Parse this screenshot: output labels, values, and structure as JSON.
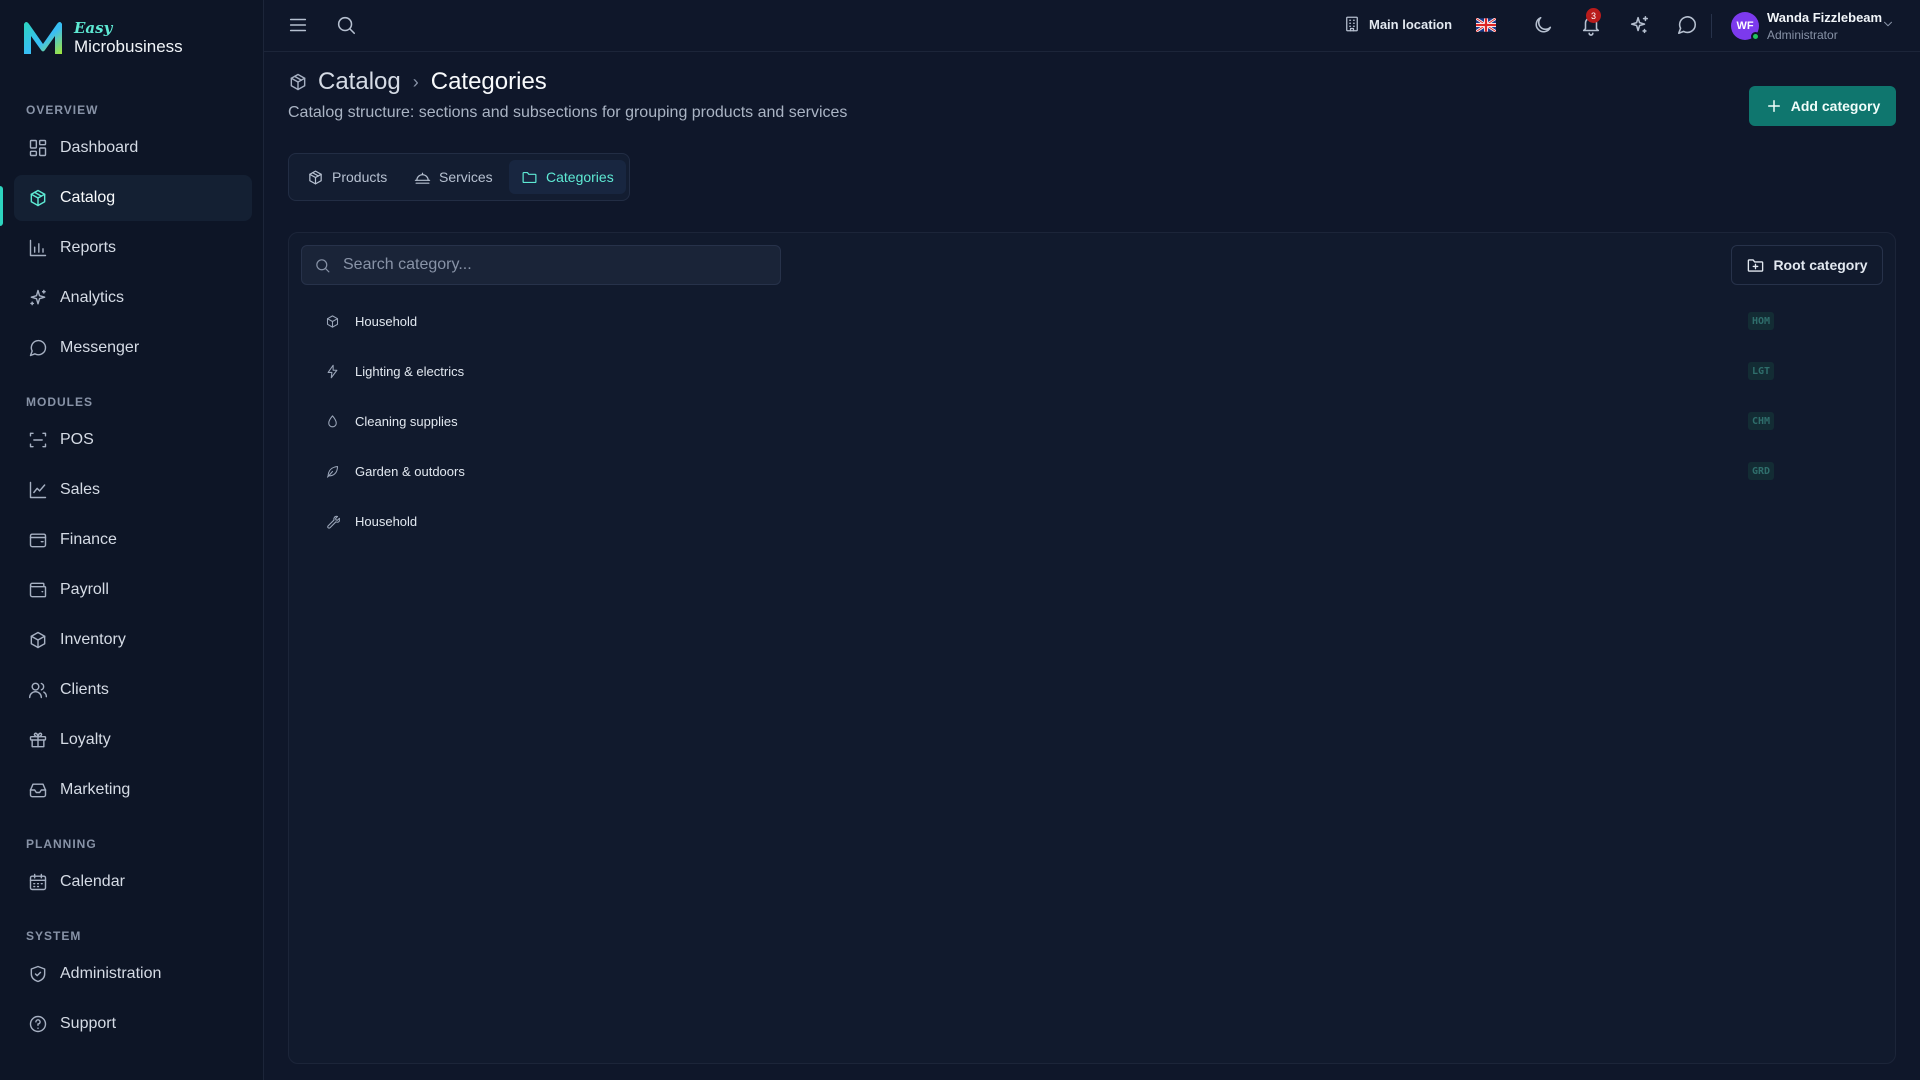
{
  "brand": {
    "line1": "Easy",
    "line2": "Microbusiness"
  },
  "sidebar": {
    "sections": [
      {
        "title": "OVERVIEW",
        "items": [
          {
            "label": "Dashboard",
            "icon": "dashboard-icon"
          },
          {
            "label": "Catalog",
            "icon": "catalog-icon",
            "active": true
          },
          {
            "label": "Reports",
            "icon": "reports-icon"
          },
          {
            "label": "Analytics",
            "icon": "analytics-icon"
          },
          {
            "label": "Messenger",
            "icon": "messenger-icon"
          }
        ]
      },
      {
        "title": "MODULES",
        "items": [
          {
            "label": "POS",
            "icon": "pos-icon"
          },
          {
            "label": "Sales",
            "icon": "sales-icon"
          },
          {
            "label": "Finance",
            "icon": "finance-icon"
          },
          {
            "label": "Payroll",
            "icon": "payroll-icon"
          },
          {
            "label": "Inventory",
            "icon": "inventory-icon"
          },
          {
            "label": "Clients",
            "icon": "clients-icon"
          },
          {
            "label": "Loyalty",
            "icon": "loyalty-icon"
          },
          {
            "label": "Marketing",
            "icon": "marketing-icon"
          }
        ]
      },
      {
        "title": "PLANNING",
        "items": [
          {
            "label": "Calendar",
            "icon": "calendar-icon"
          }
        ]
      },
      {
        "title": "SYSTEM",
        "items": [
          {
            "label": "Administration",
            "icon": "shield-icon"
          },
          {
            "label": "Support",
            "icon": "help-icon"
          }
        ]
      }
    ]
  },
  "topbar": {
    "location": "Main location",
    "notifications_count": "3",
    "user": {
      "initials": "WF",
      "name": "Wanda Fizzlebeam",
      "role": "Administrator"
    }
  },
  "header": {
    "breadcrumb_parent": "Catalog",
    "breadcrumb_separator": "›",
    "title": "Categories",
    "subtitle": "Catalog structure: sections and subsections for grouping products and services",
    "add_button": "Add category"
  },
  "tabs": [
    {
      "label": "Products",
      "icon": "box-icon"
    },
    {
      "label": "Services",
      "icon": "services-icon"
    },
    {
      "label": "Categories",
      "icon": "folder-icon",
      "active": true
    }
  ],
  "panel": {
    "search_placeholder": "Search category...",
    "root_button": "Root category",
    "categories": [
      {
        "name": "Household",
        "code": "HOM",
        "icon": "package-icon"
      },
      {
        "name": "Lighting & electrics",
        "code": "LGT",
        "icon": "lightning-icon"
      },
      {
        "name": "Cleaning supplies",
        "code": "CHM",
        "icon": "droplet-icon"
      },
      {
        "name": "Garden & outdoors",
        "code": "GRD",
        "icon": "leaf-icon"
      },
      {
        "name": "Household",
        "code": "",
        "icon": "wrench-icon"
      }
    ]
  },
  "colors": {
    "background": "#0f172a",
    "sidebar": "#0d1526",
    "accent": "#2dd4bf",
    "primary_button": "#0f766e",
    "badge": "#b91c1c",
    "avatar": "#7c3aed"
  }
}
